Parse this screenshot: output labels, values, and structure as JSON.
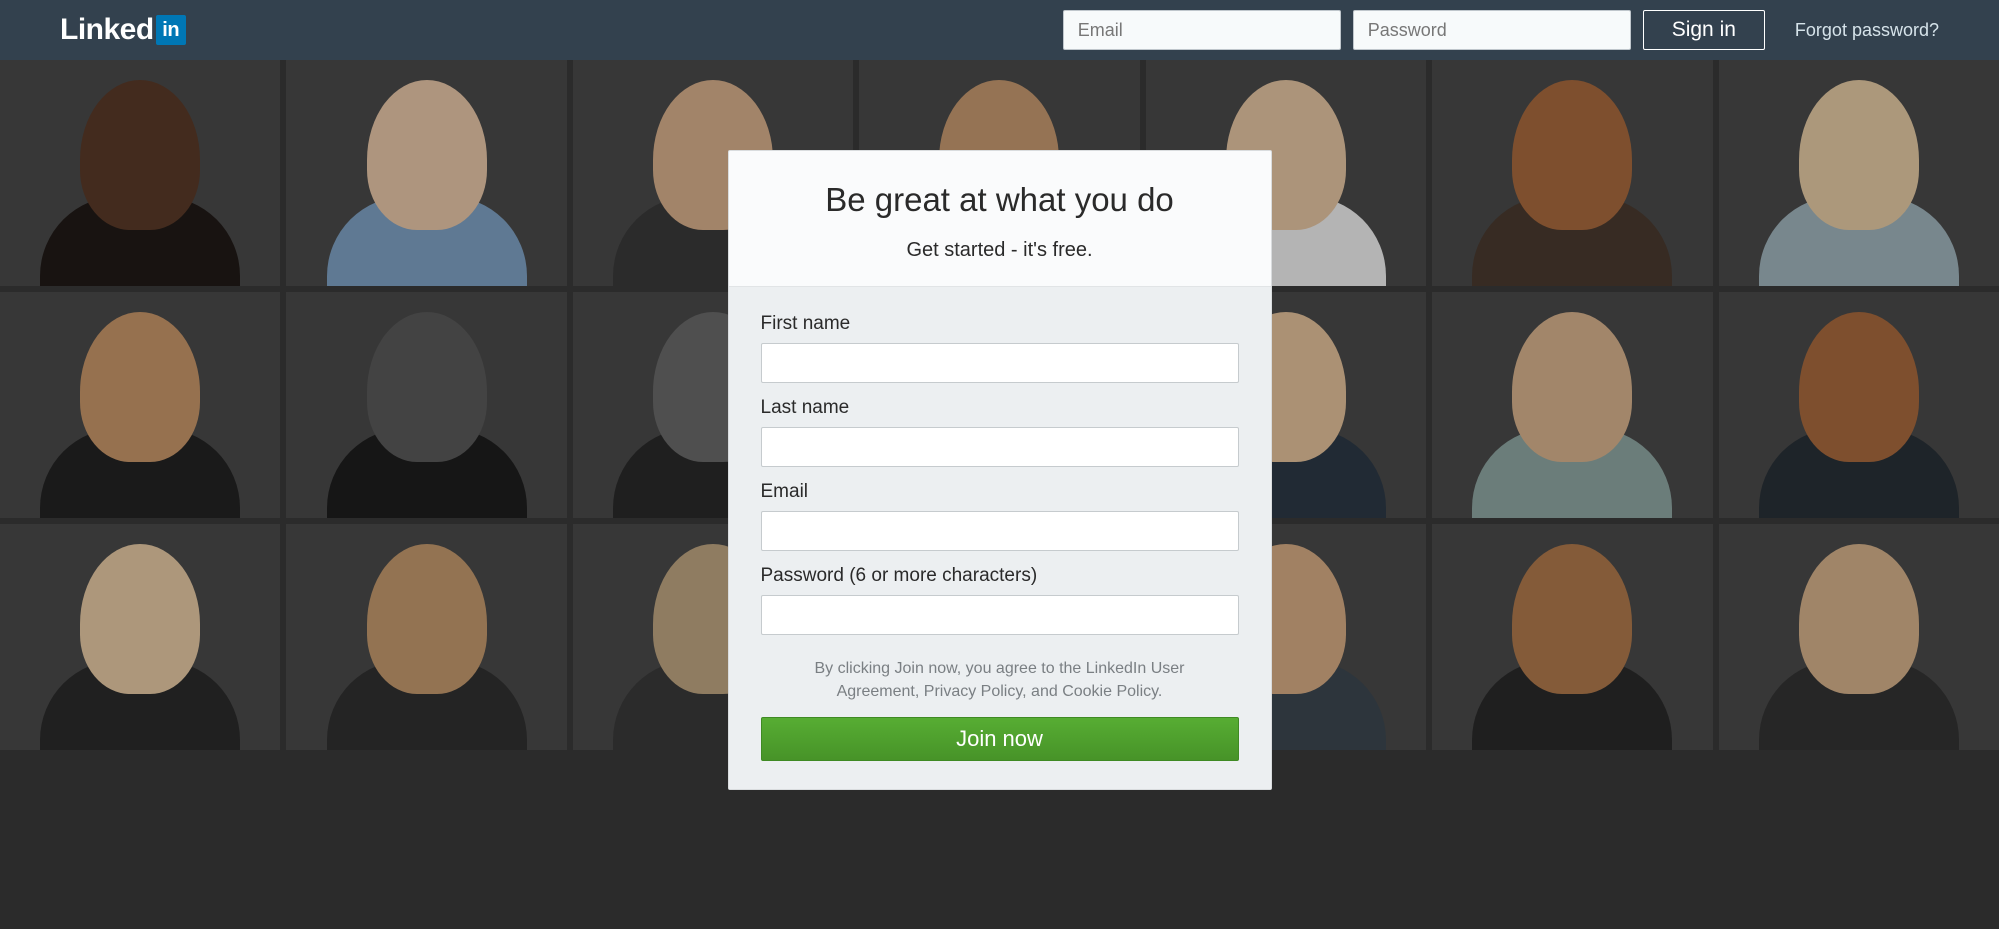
{
  "header": {
    "logo_text": "Linked",
    "logo_badge": "in",
    "email_placeholder": "Email",
    "password_placeholder": "Password",
    "signin_label": "Sign in",
    "forgot_label": "Forgot password?"
  },
  "signup": {
    "headline": "Be great at what you do",
    "subhead": "Get started - it's free.",
    "first_name_label": "First name",
    "last_name_label": "Last name",
    "email_label": "Email",
    "password_label": "Password (6 or more characters)",
    "legal_text": "By clicking Join now, you agree to the LinkedIn User Agreement, Privacy Policy, and Cookie Policy.",
    "join_label": "Join now"
  },
  "background": {
    "tiles": [
      {
        "skin": "#5a3a28",
        "shirt": "#201a17"
      },
      {
        "skin": "#e8c7a8",
        "shirt": "#7fa2c4"
      },
      {
        "skin": "#d9b08c",
        "shirt": "#3a3a3a"
      },
      {
        "skin": "#c79a70",
        "shirt": "#5a5a5a"
      },
      {
        "skin": "#e6c6a3",
        "shirt": "#f0f0f0"
      },
      {
        "skin": "#a86a3e",
        "shirt": "#4a3a2f"
      },
      {
        "skin": "#e6cba4",
        "shirt": "#a0b4bd"
      },
      {
        "skin": "#c9976a",
        "shirt": "#232323"
      },
      {
        "skin": "#5a5a5a",
        "shirt": "#1e1e1e"
      },
      {
        "skin": "#6a6a6a",
        "shirt": "#2a2a2a"
      },
      {
        "skin": "#c88856",
        "shirt": "#b63a3f"
      },
      {
        "skin": "#e4c29b",
        "shirt": "#2d3946"
      },
      {
        "skin": "#d8b38e",
        "shirt": "#8fa7a3"
      },
      {
        "skin": "#a86a3e",
        "shirt": "#293037"
      },
      {
        "skin": "#e7caa4",
        "shirt": "#2b2b2b"
      },
      {
        "skin": "#c49a6e",
        "shirt": "#303030"
      },
      {
        "skin": "#bfa682",
        "shirt": "#3a3a3a"
      },
      {
        "skin": "#e7cba2",
        "shirt": "#c8502a"
      },
      {
        "skin": "#d7ad84",
        "shirt": "#3c4750"
      },
      {
        "skin": "#b07a4c",
        "shirt": "#2a2a2a"
      },
      {
        "skin": "#d6b28b",
        "shirt": "#333"
      }
    ]
  }
}
